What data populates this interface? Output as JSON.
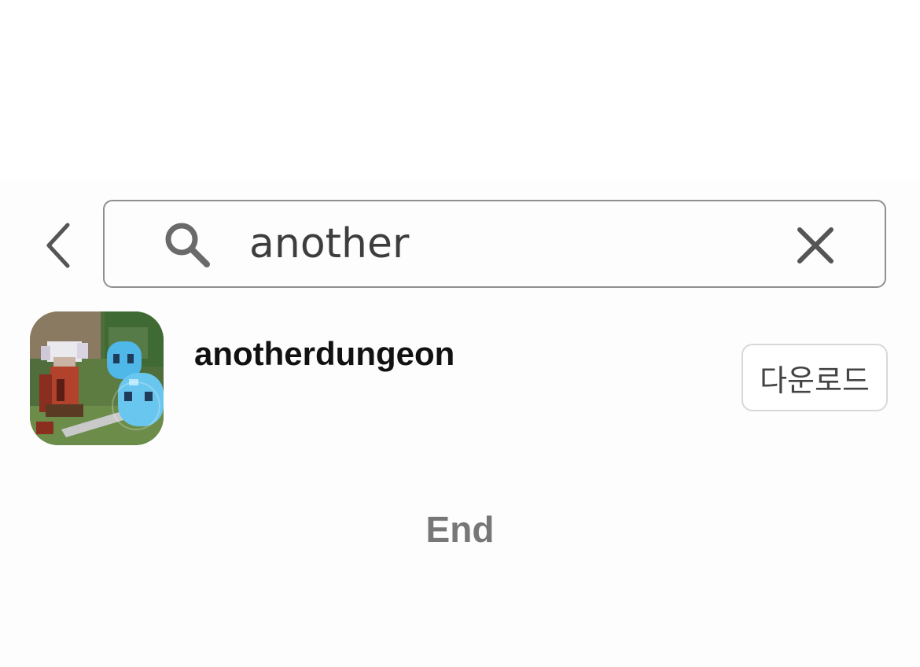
{
  "search": {
    "query": "another",
    "back_icon": "chevron-left-icon",
    "search_icon": "search-icon",
    "clear_icon": "close-icon"
  },
  "results": [
    {
      "name": "anotherdungeon",
      "icon": "game-app-icon",
      "download_label": "다운로드"
    }
  ],
  "footer": {
    "end_label": "End"
  },
  "colors": {
    "border": "#8f8f8f",
    "text": "#111111",
    "muted": "#777777",
    "button_border": "#d8d8d8"
  }
}
